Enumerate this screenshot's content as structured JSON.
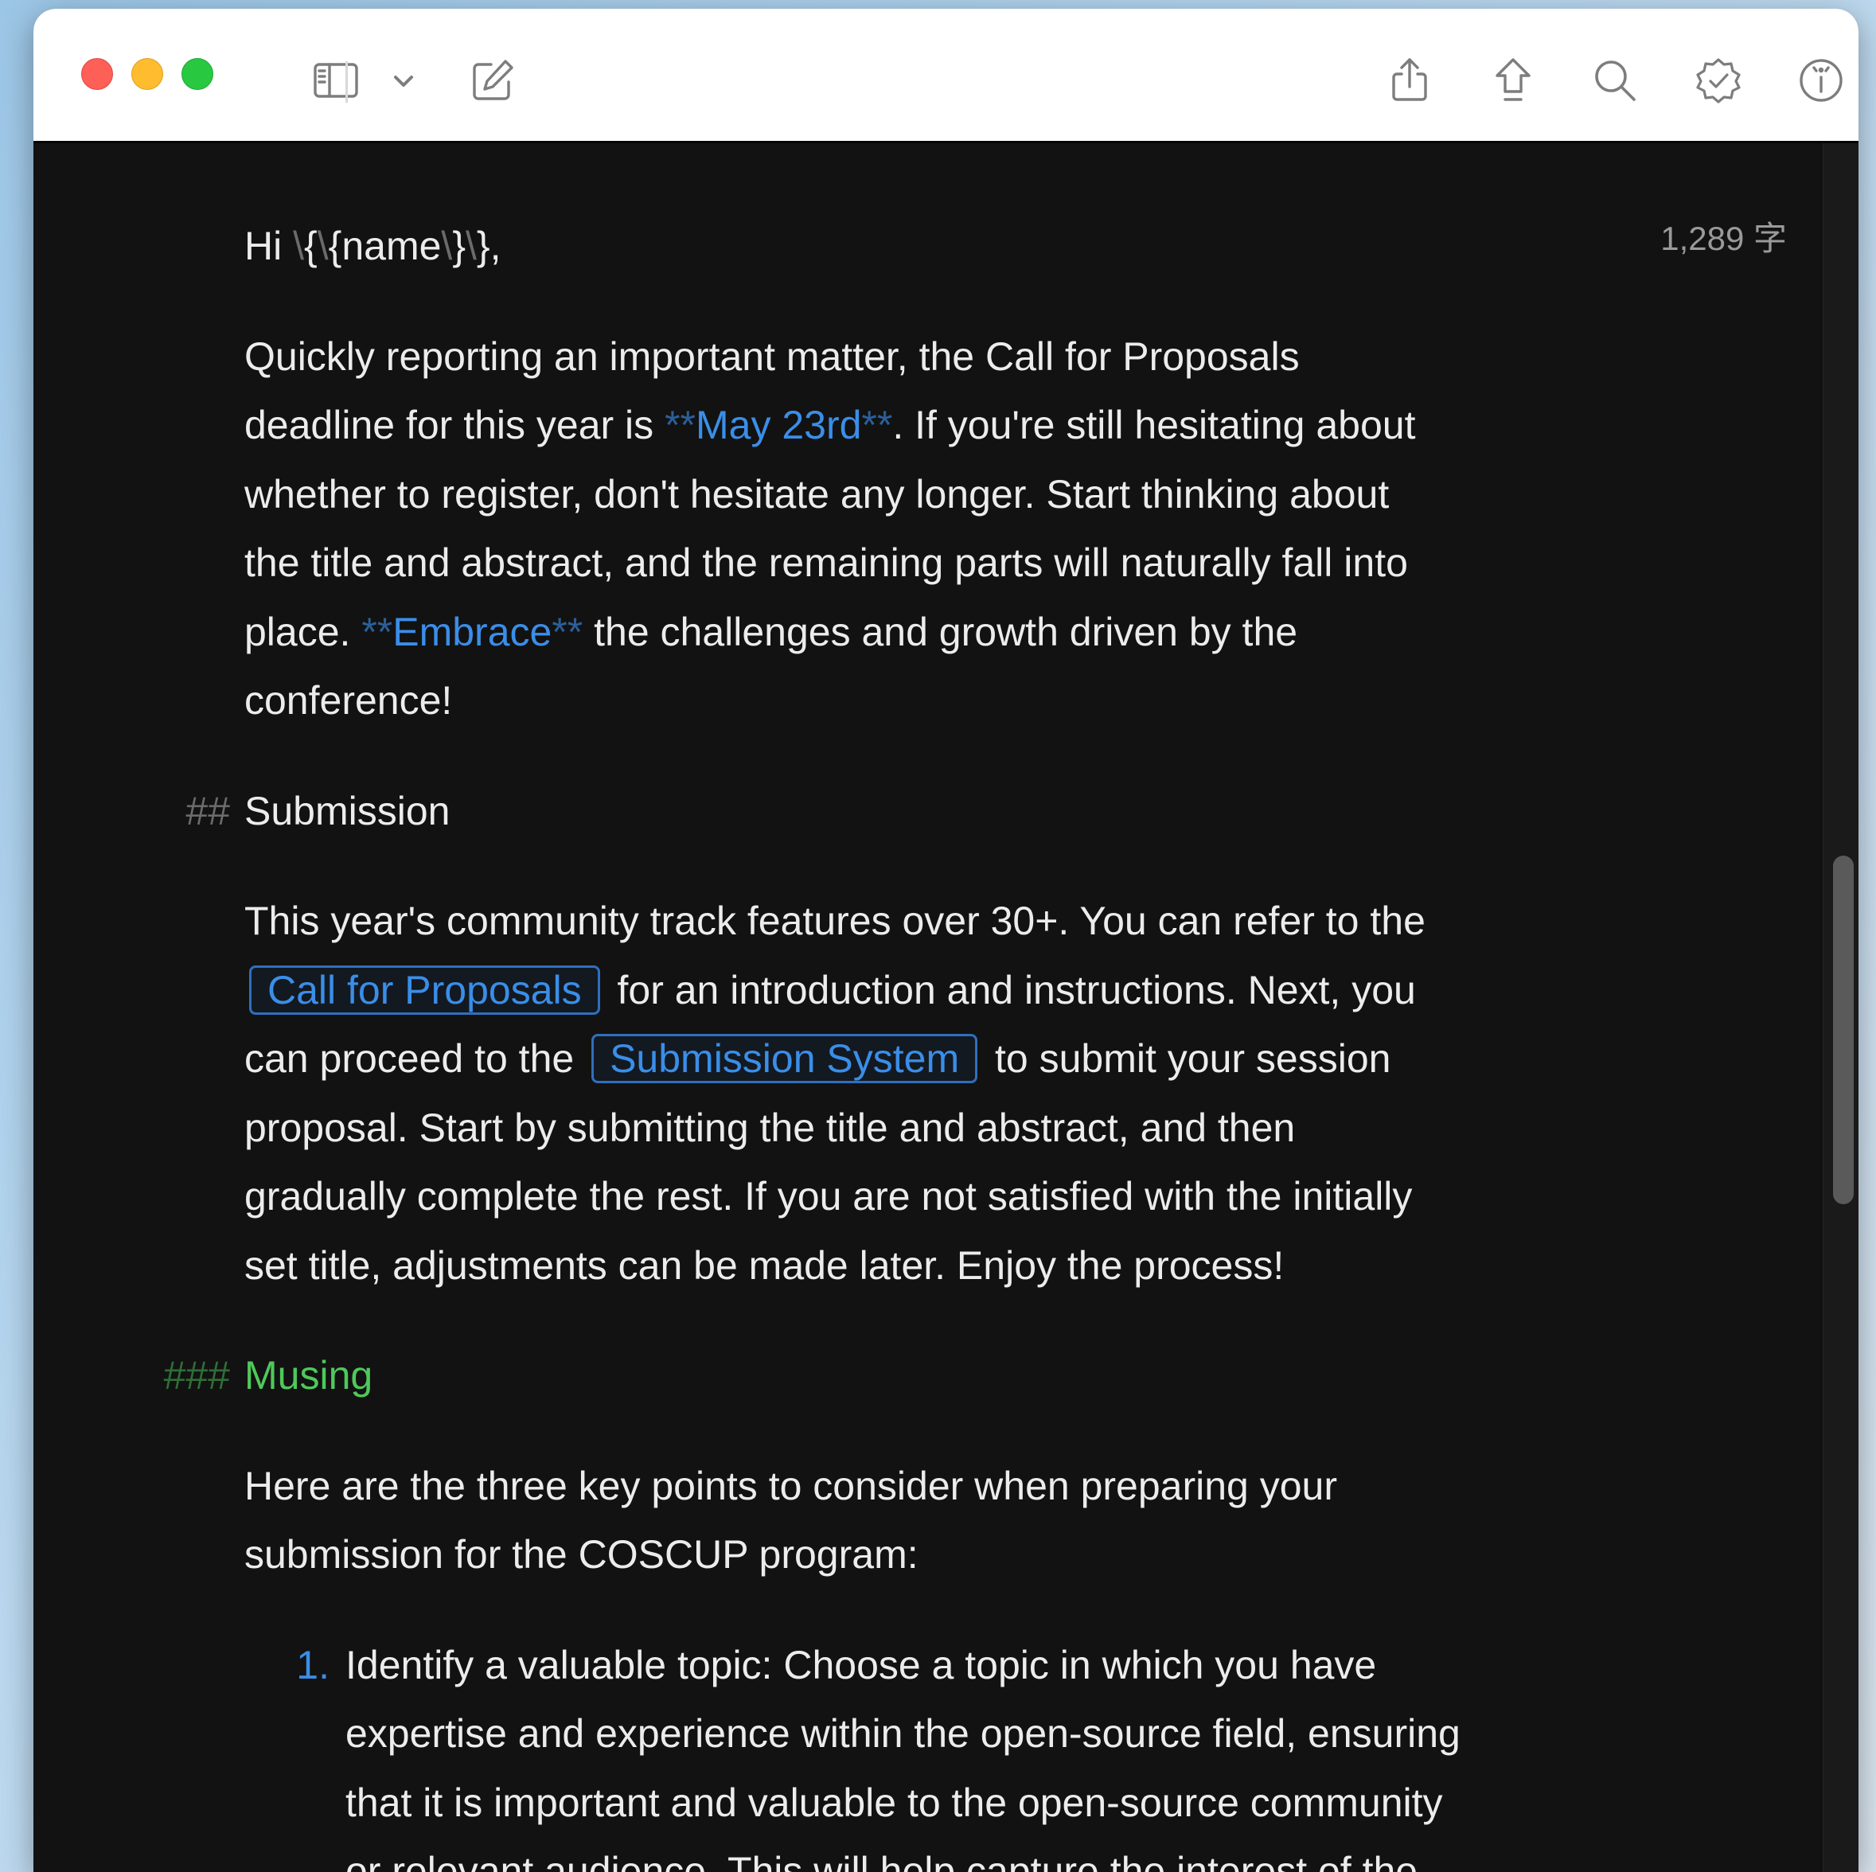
{
  "toolbar": {
    "icons": [
      "sidebar-icon",
      "chevron-down-icon",
      "compose-icon",
      "share-icon",
      "export-icon",
      "search-icon",
      "badge-check-icon",
      "info-icon"
    ]
  },
  "status": {
    "word_count": "1,289 字"
  },
  "doc": {
    "greeting": {
      "hi": "Hi ",
      "b1": "\\",
      "t1": "{",
      "b2": "\\",
      "t2": "{name",
      "b3": "\\",
      "t3": "}",
      "b4": "\\",
      "t4": "},"
    },
    "para1": {
      "l1": "Quickly reporting an important matter, the Call for Proposals",
      "l2a": "deadline for this year is ",
      "l2_mark_open": "**",
      "l2_bold": "May 23rd",
      "l2_mark_close": "**",
      "l2b": ". If you're still hesitating about",
      "l3": "whether to register, don't hesitate any longer. Start thinking about",
      "l4": "the title and abstract, and the remaining parts will naturally fall into",
      "l5a": "place. ",
      "l5_mark_open": "**",
      "l5_bold": "Embrace",
      "l5_mark_close": "**",
      "l5b": " the challenges and growth driven by the",
      "l6": "conference!"
    },
    "h2": {
      "hash": "##",
      "text": "Submission"
    },
    "para2": {
      "l1": "This year's community track features over 30+. You can refer to the",
      "l2_link": "Call for Proposals",
      "l2b": " for an introduction and instructions. Next, you",
      "l3a": "can proceed to the ",
      "l3_link": "Submission System",
      "l3b": " to submit your session",
      "l4": "proposal. Start by submitting the title and abstract, and then",
      "l5": "gradually complete the rest. If you are not satisfied with the initially",
      "l6": "set title, adjustments can be made later. Enjoy the process!"
    },
    "h3": {
      "hash": "###",
      "text": "Musing"
    },
    "para3": {
      "l1": "Here are the three key points to consider when preparing your",
      "l2": "submission for the COSCUP program:"
    },
    "list": {
      "num": "1.",
      "l1": "Identify a valuable topic: Choose a topic in which you have",
      "l2": "expertise and experience within the open-source field, ensuring",
      "l3": "that it is important and valuable to the open-source community",
      "l4": "or relevant audience. This will help capture the interest of the"
    }
  }
}
